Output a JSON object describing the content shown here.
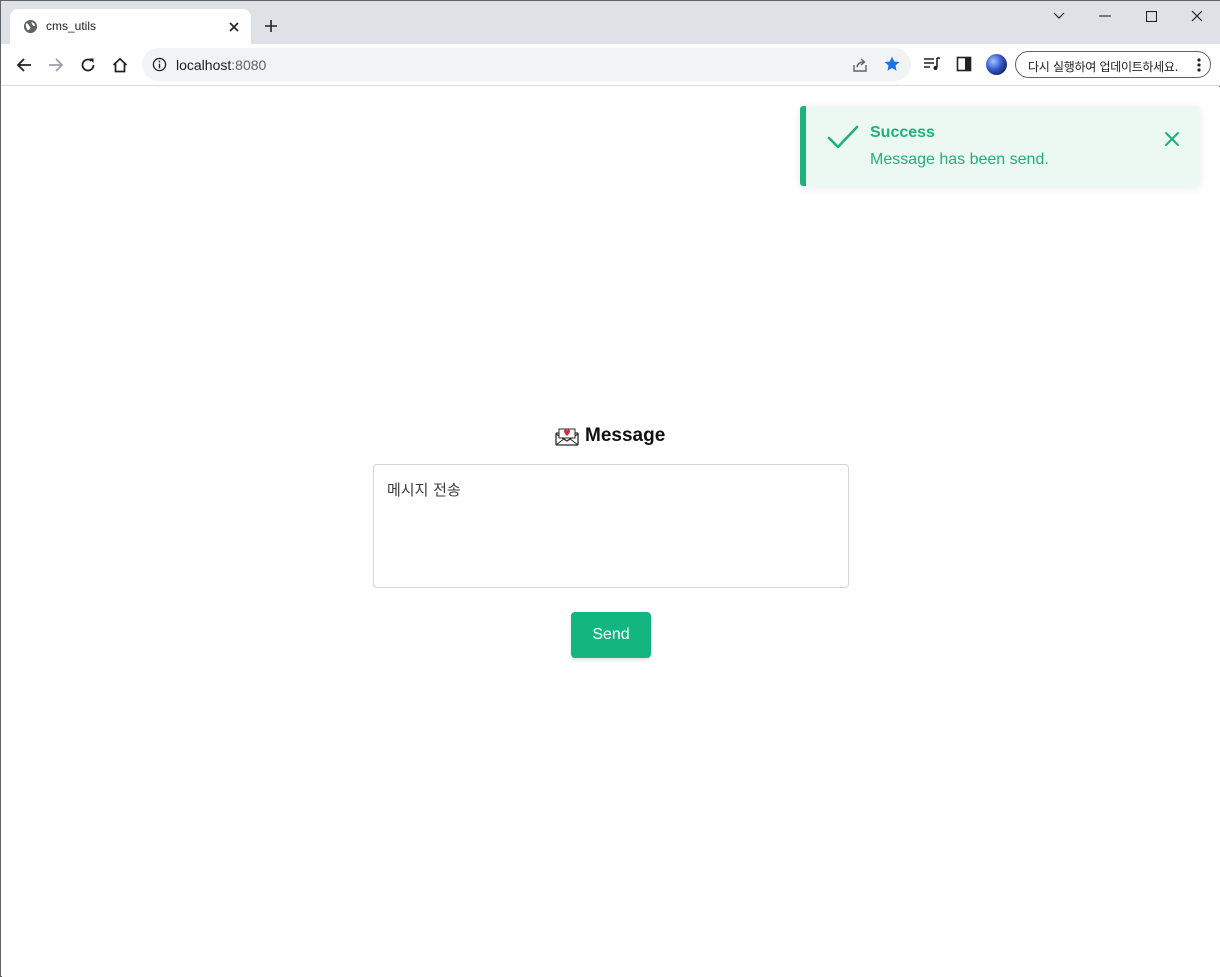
{
  "browser": {
    "tab": {
      "title": "cms_utils",
      "favicon": "globe-icon"
    },
    "address_bar": {
      "host": "localhost",
      "port": ":8080"
    },
    "update_button": {
      "label": "다시 실행하여 업데이트하세요."
    },
    "colors": {
      "star": "#1a73e8",
      "tabstrip": "#dee1e6"
    }
  },
  "toast": {
    "title": "Success",
    "message": "Message has been send.",
    "icon": "checkmark-icon",
    "colors": {
      "accent": "#1eb27a",
      "background": "#ecf8f2"
    }
  },
  "message_form": {
    "heading": "Message",
    "heading_icon": "love-letter-envelope-icon",
    "textarea_value": "메시지 전송",
    "send_label": "Send",
    "colors": {
      "button": "#12b67e"
    }
  }
}
